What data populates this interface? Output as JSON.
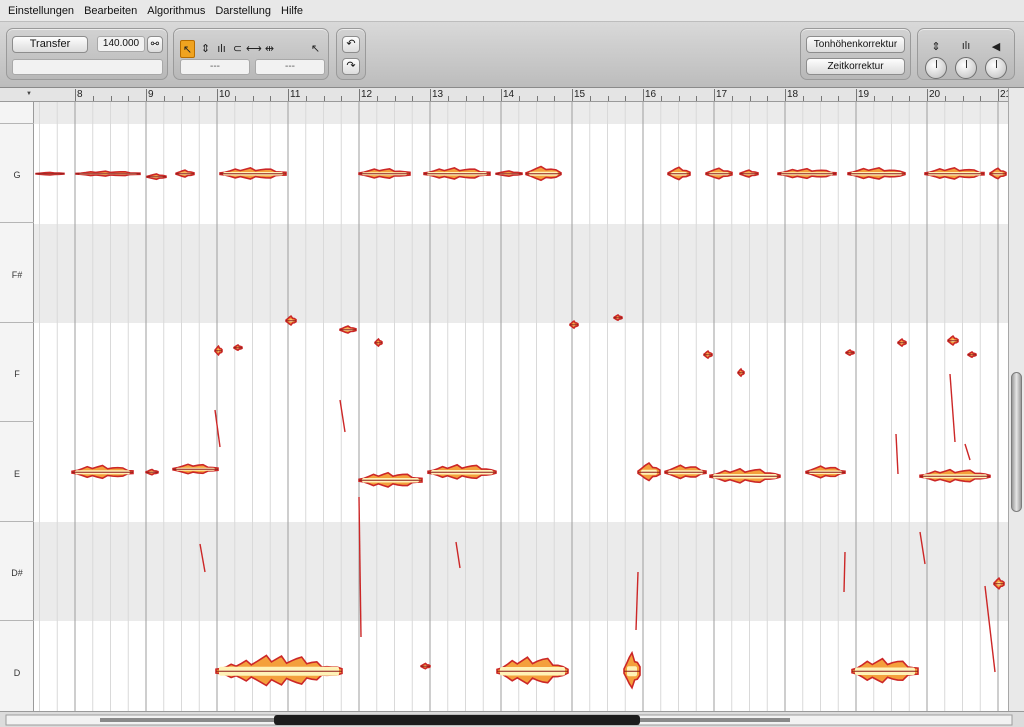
{
  "menu": [
    "Einstellungen",
    "Bearbeiten",
    "Algorithmus",
    "Darstellung",
    "Hilfe"
  ],
  "toolbar": {
    "transfer_label": "Transfer",
    "tempo_value": "140.000",
    "transfer_status": "",
    "tool_field_left": "---",
    "tool_field_right": "---",
    "pitch_correction_label": "Tonhöhenkorrektur",
    "time_correction_label": "Zeitkorrektur"
  },
  "ruler": [
    "8",
    "9",
    "10",
    "11",
    "12",
    "13",
    "14",
    "15",
    "16",
    "17",
    "18",
    "19",
    "20",
    "21"
  ],
  "pitches": [
    "G",
    "F#",
    "F",
    "E",
    "D#",
    "D"
  ],
  "blob_colors": {
    "edge": "#cc2727",
    "fill": "#f4a03c",
    "core": "#fff3b8",
    "line": "#8e1b1b"
  }
}
